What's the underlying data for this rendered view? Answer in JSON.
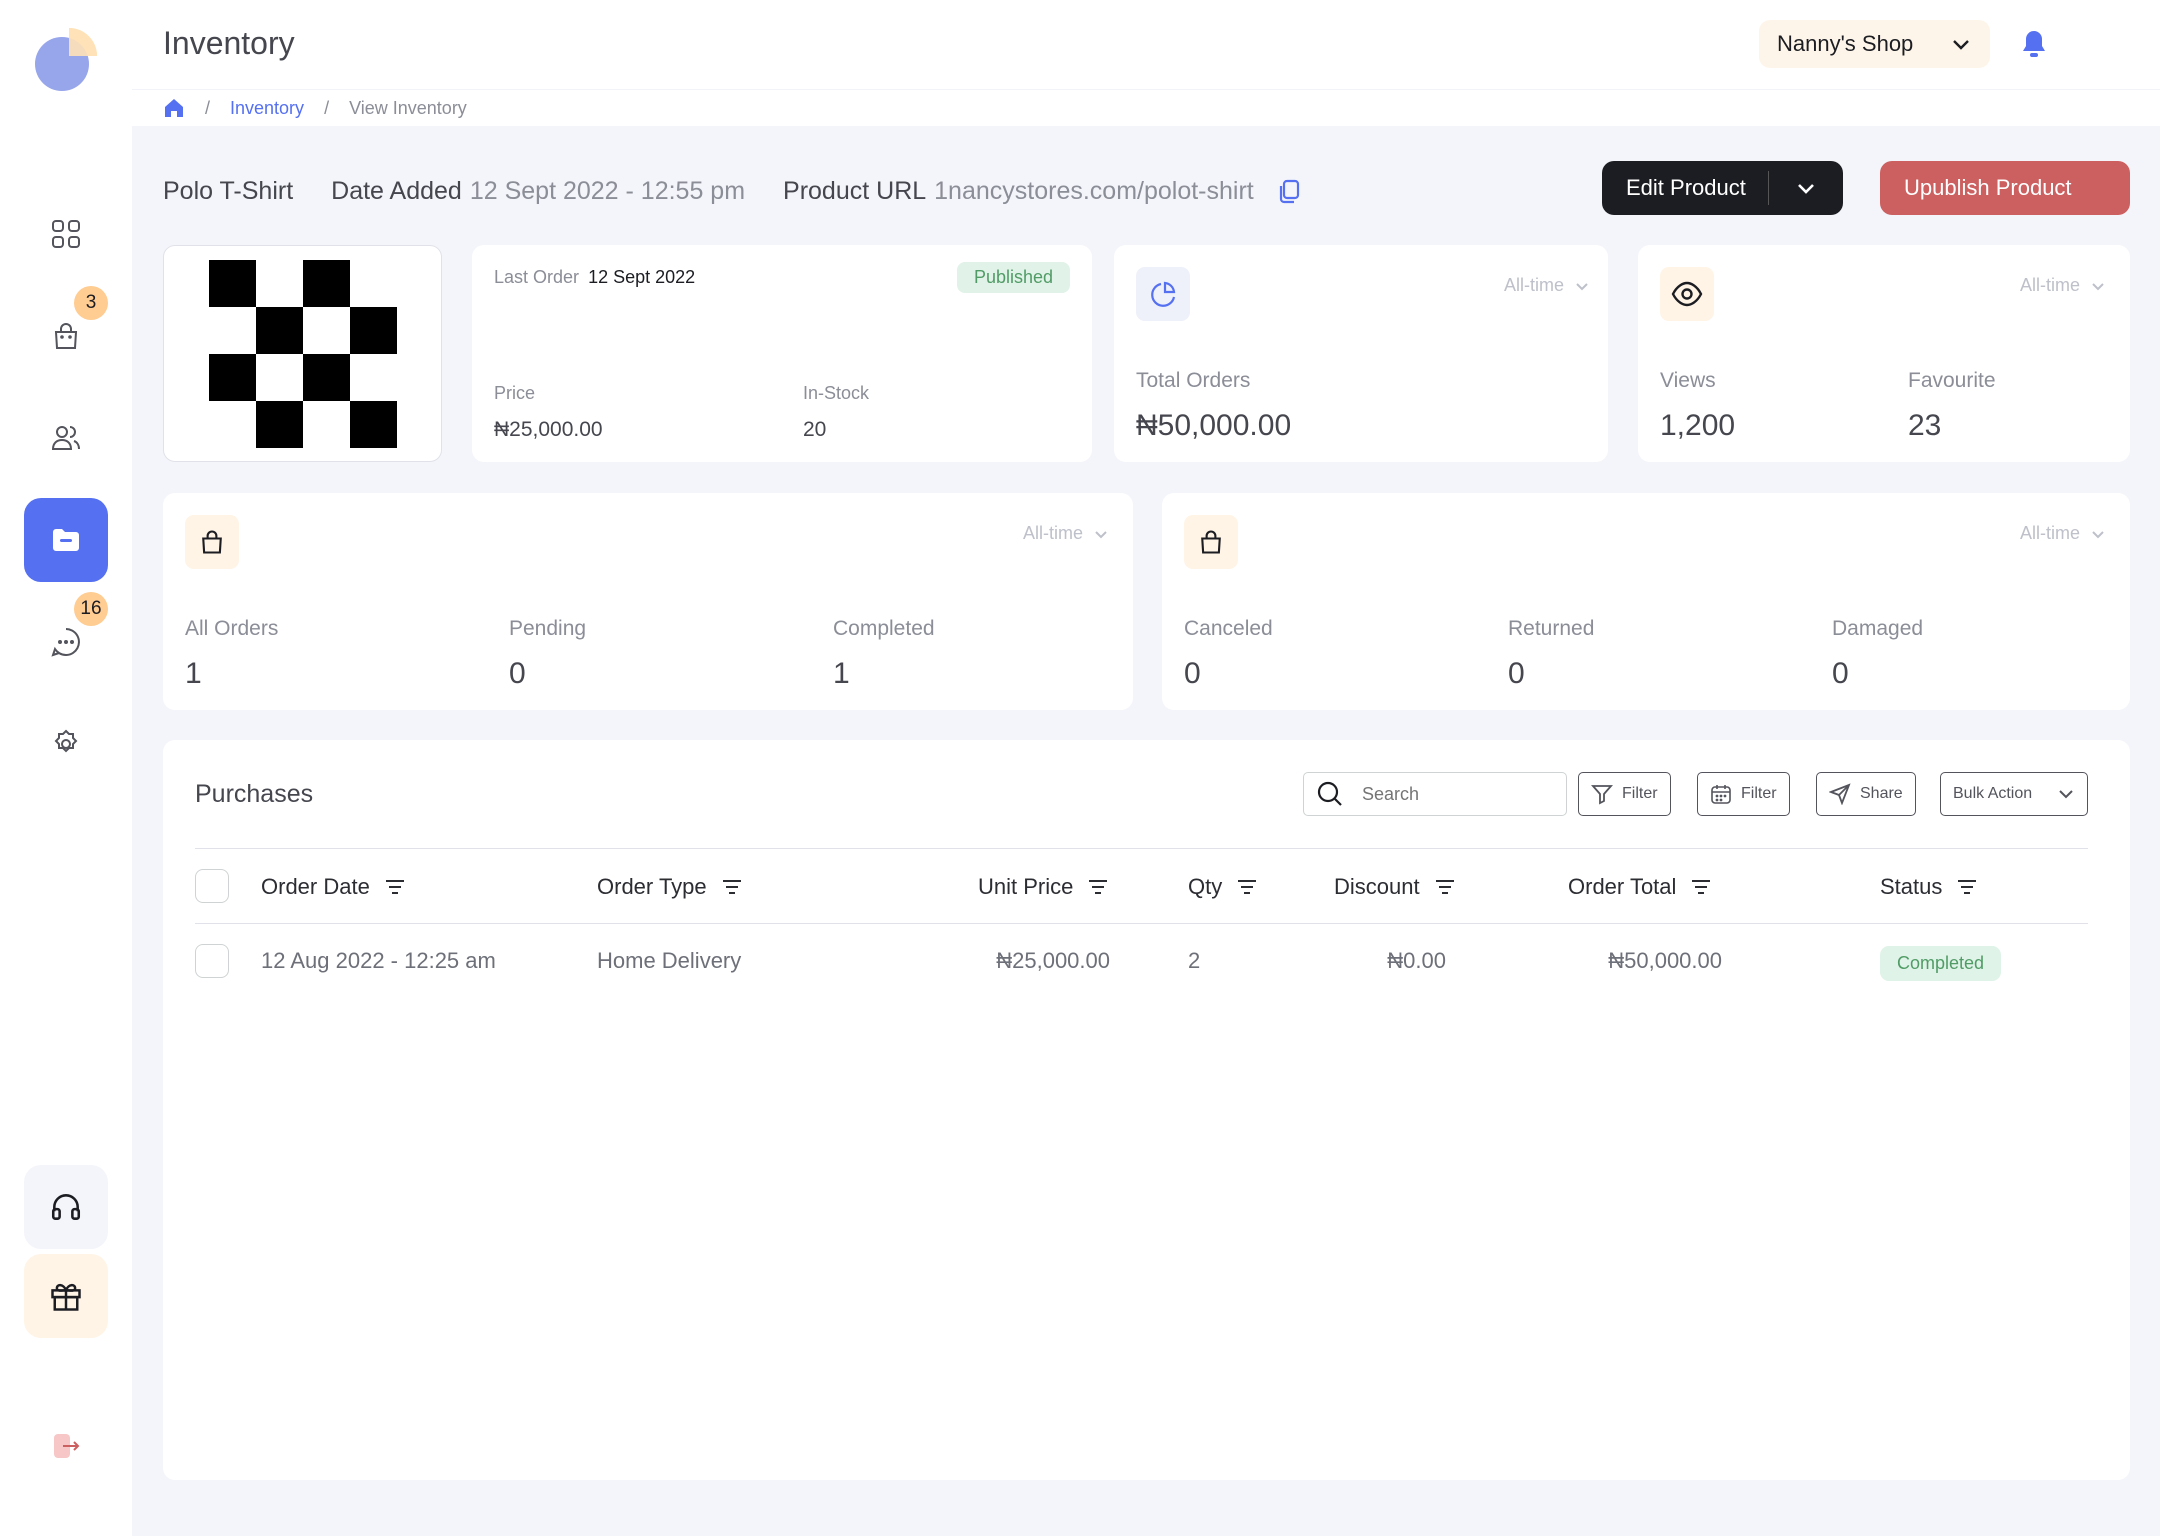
{
  "header": {
    "title": "Inventory",
    "shop_name": "Nanny's Shop"
  },
  "sidebar": {
    "items": [
      {
        "name": "dashboard",
        "icon": "grid-icon"
      },
      {
        "name": "orders",
        "icon": "bag-icon",
        "badge": "3"
      },
      {
        "name": "customers",
        "icon": "users-icon"
      },
      {
        "name": "inventory",
        "icon": "folder-icon",
        "active": true
      },
      {
        "name": "conversations",
        "icon": "chat-icon",
        "badge": "16"
      },
      {
        "name": "settings",
        "icon": "gear-icon"
      }
    ],
    "bottom": [
      {
        "name": "support",
        "icon": "headphones-icon"
      },
      {
        "name": "gift",
        "icon": "gift-icon"
      },
      {
        "name": "logout",
        "icon": "logout-icon"
      }
    ]
  },
  "breadcrumb": {
    "home_icon": "home-icon",
    "items": [
      "Inventory",
      "View Inventory"
    ]
  },
  "product": {
    "name": "Polo T-Shirt",
    "date_added_label": "Date Added",
    "date_added": "12 Sept 2022 - 12:55 pm",
    "url_label": "Product URL",
    "url": "1nancystores.com/polot-shirt",
    "edit_label": "Edit Product",
    "unpublish_label": "Upublish Product"
  },
  "summary": {
    "last_order_label": "Last Order",
    "last_order": "12 Sept 2022",
    "status": "Published",
    "price_label": "Price",
    "price": "₦25,000.00",
    "stock_label": "In-Stock",
    "stock": "20"
  },
  "total_orders": {
    "period": "All-time",
    "label": "Total Orders",
    "value": "₦50,000.00"
  },
  "views": {
    "period": "All-time",
    "views_label": "Views",
    "views": "1,200",
    "fav_label": "Favourite",
    "fav": "23"
  },
  "orders_card": {
    "period": "All-time",
    "stats": [
      {
        "label": "All Orders",
        "value": "1"
      },
      {
        "label": "Pending",
        "value": "0"
      },
      {
        "label": "Completed",
        "value": "1"
      }
    ]
  },
  "issues_card": {
    "period": "All-time",
    "stats": [
      {
        "label": "Canceled",
        "value": "0"
      },
      {
        "label": "Returned",
        "value": "0"
      },
      {
        "label": "Damaged",
        "value": "0"
      }
    ]
  },
  "purchases": {
    "title": "Purchases",
    "search_placeholder": "Search",
    "filter_label": "Filter",
    "date_filter_label": "Filter",
    "share_label": "Share",
    "bulk_label": "Bulk Action",
    "columns": [
      "Order Date",
      "Order Type",
      "Unit Price",
      "Qty",
      "Discount",
      "Order Total",
      "Status"
    ],
    "rows": [
      {
        "date": "12 Aug 2022 - 12:25 am",
        "type": "Home Delivery",
        "unit_price": "₦25,000.00",
        "qty": "2",
        "discount": "₦0.00",
        "total": "₦50,000.00",
        "status": "Completed"
      }
    ]
  },
  "colors": {
    "accent": "#5570f1",
    "danger": "#cc5f5f",
    "badge": "#ffcc91",
    "success": "#519c66"
  }
}
